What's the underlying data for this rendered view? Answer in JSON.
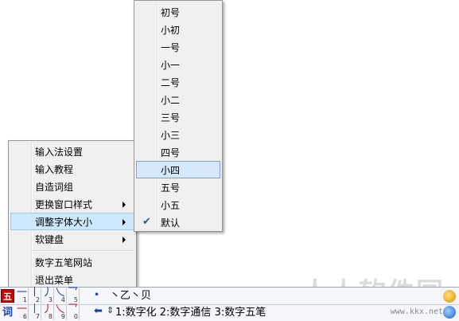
{
  "context_menu": {
    "items": [
      {
        "label": "输入法设置",
        "has_submenu": false
      },
      {
        "label": "输入教程",
        "has_submenu": false
      },
      {
        "label": "自造词组",
        "has_submenu": false
      },
      {
        "label": "更换窗口样式",
        "has_submenu": true
      },
      {
        "label": "调整字体大小",
        "has_submenu": true,
        "highlighted": true
      },
      {
        "label": "软键盘",
        "has_submenu": true
      },
      {
        "label": "数字五笔网站",
        "has_submenu": false
      },
      {
        "label": "退出菜单",
        "has_submenu": false
      }
    ]
  },
  "font_size_submenu": {
    "items": [
      {
        "label": "初号"
      },
      {
        "label": "小初"
      },
      {
        "label": "一号"
      },
      {
        "label": "小一"
      },
      {
        "label": "二号"
      },
      {
        "label": "小二"
      },
      {
        "label": "三号"
      },
      {
        "label": "小三"
      },
      {
        "label": "四号"
      },
      {
        "label": "小四",
        "hovered": true
      },
      {
        "label": "五号"
      },
      {
        "label": "小五"
      },
      {
        "label": "默认",
        "checked": true
      }
    ],
    "check_glyph": "✔"
  },
  "ime_bar": {
    "mode_icon_top": "五",
    "mode_icon_bottom": "词",
    "row1_strokes": [
      {
        "glyph": "一",
        "num": "1"
      },
      {
        "glyph": "丨",
        "num": "2"
      },
      {
        "glyph": "丿",
        "num": "3"
      },
      {
        "glyph": "乀",
        "num": "4"
      },
      {
        "glyph": "乛",
        "num": "5"
      }
    ],
    "row2_strokes": [
      {
        "glyph": "一",
        "num": "6"
      },
      {
        "glyph": "丨",
        "num": "7"
      },
      {
        "glyph": "丿",
        "num": "8"
      },
      {
        "glyph": "乀",
        "num": "9"
      },
      {
        "glyph": "乛",
        "num": "0"
      }
    ],
    "dot_glyph": "•",
    "composition": "丶乙丶贝",
    "back_glyph": "⬅",
    "updown_glyph": "⇕",
    "candidates": "1:数字化 2:数字通信 3:数字五笔",
    "tray_icons": [
      "sun-icon",
      "globe-icon"
    ]
  },
  "watermark": {
    "text": "人人软件园",
    "url": "www.kkx.net"
  }
}
